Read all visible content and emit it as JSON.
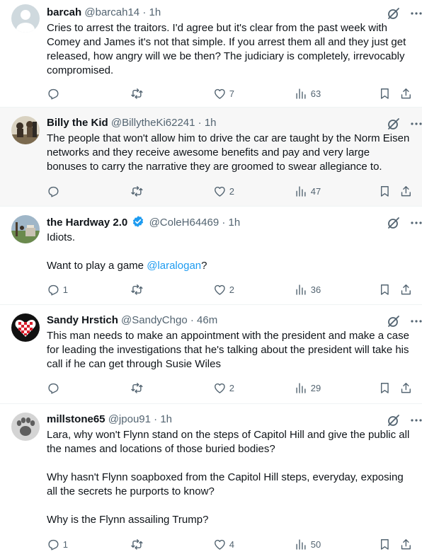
{
  "posts": [
    {
      "name": "barcah",
      "handle": "@barcah14",
      "time": "1h",
      "text": [
        "Cries to arrest the traitors. I'd agree but it's clear from the past week with Comey and James it's not that simple. If you arrest them all and they just get released, how angry will we be then? The judiciary is completely, irrevocably compromised."
      ],
      "replies": "",
      "retweets": "",
      "likes": "7",
      "views": "63"
    },
    {
      "name": "Billy the Kid",
      "handle": "@BillytheKi62241",
      "time": "1h",
      "text": [
        "The people that won't allow him to drive the car are taught by the Norm Eisen networks and they receive awesome benefits and pay and very large bonuses to carry the narrative they are groomed to swear allegiance to."
      ],
      "replies": "",
      "retweets": "",
      "likes": "2",
      "views": "47"
    },
    {
      "name": "the Hardway 2.0",
      "handle": "@ColeH64469",
      "time": "1h",
      "text": [
        "Idiots.",
        "",
        "Want to play a game"
      ],
      "mention": "@laralogan",
      "mention_suffix": "?",
      "replies": "1",
      "retweets": "",
      "likes": "2",
      "views": "36"
    },
    {
      "name": "Sandy Hrstich",
      "handle": "@SandyChgo",
      "time": "46m",
      "text": [
        "This man needs to make an appointment with the president and make a case for leading the investigations that he's talking about  the president will take his call if he can get through Susie Wiles"
      ],
      "replies": "",
      "retweets": "",
      "likes": "2",
      "views": "29"
    },
    {
      "name": "millstone65",
      "handle": "@jpou91",
      "time": "1h",
      "text": [
        "Lara, why won't Flynn stand on the steps of Capitol Hill and give the public all the names and locations of those buried bodies?",
        "",
        "Why hasn't Flynn soapboxed from the Capitol Hill steps, everyday, exposing all the secrets he purports to know?",
        "",
        "Why is the Flynn assailing Trump?"
      ],
      "replies": "1",
      "retweets": "",
      "likes": "4",
      "views": "50"
    }
  ],
  "separator": "·",
  "colors": {
    "text": "#0f1419",
    "secondary": "#536471",
    "link": "#1d9bf0",
    "verified": "#1d9bf0",
    "border": "#eff3f4",
    "highlight_bg": "#f7f7f7"
  },
  "icons": [
    "grok-icon",
    "more-icon",
    "reply-icon",
    "retweet-icon",
    "like-icon",
    "views-icon",
    "bookmark-icon",
    "share-icon",
    "verified-badge-icon"
  ]
}
